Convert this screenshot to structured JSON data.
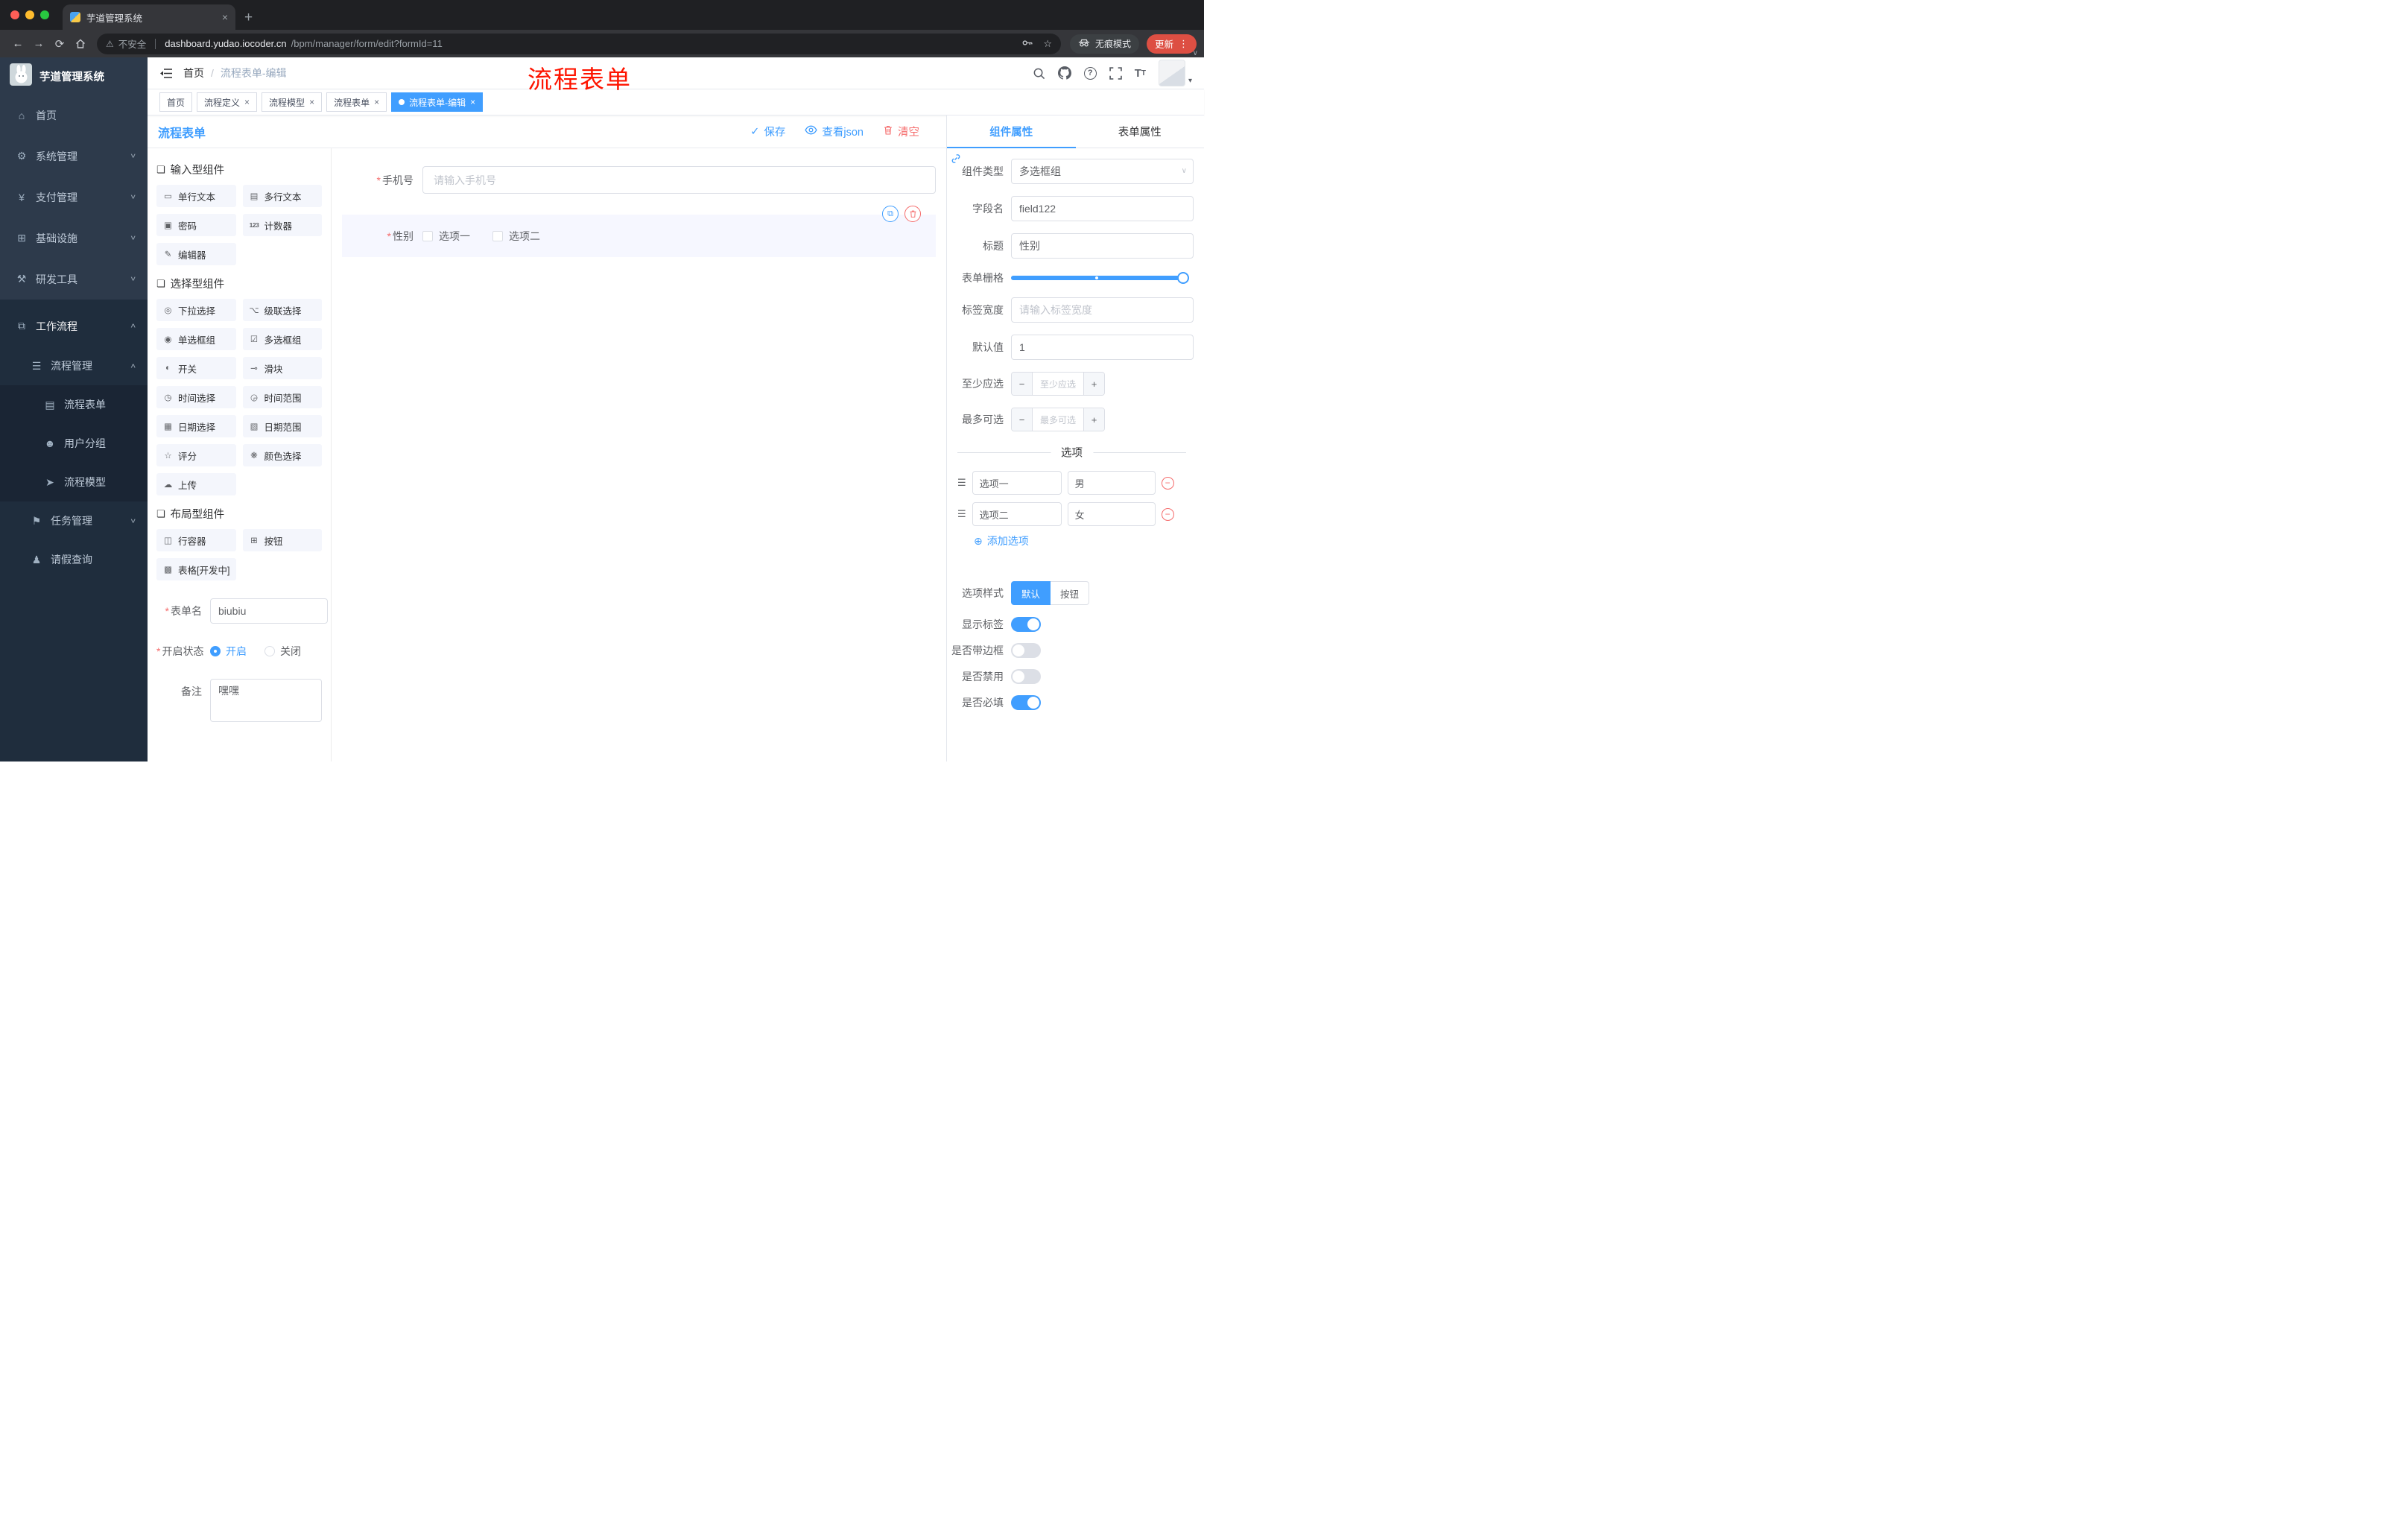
{
  "browser": {
    "tab_title": "芋道管理系统",
    "security_label": "不安全",
    "url_domain": "dashboard.yudao.iocoder.cn",
    "url_path": "/bpm/manager/form/edit?formId=11",
    "incognito_label": "无痕模式",
    "update_label": "更新"
  },
  "annotation": "流程表单",
  "sidebar": {
    "logo_title": "芋道管理系统",
    "items": [
      {
        "label": "首页",
        "icon": "⌂"
      },
      {
        "label": "系统管理",
        "icon": "⚙"
      },
      {
        "label": "支付管理",
        "icon": "¥"
      },
      {
        "label": "基础设施",
        "icon": "⊞"
      },
      {
        "label": "研发工具",
        "icon": "⚒"
      },
      {
        "label": "工作流程",
        "icon": "⧉"
      },
      {
        "label": "流程管理",
        "icon": "☰"
      },
      {
        "label": "流程表单",
        "icon": "▤"
      },
      {
        "label": "用户分组",
        "icon": "☻"
      },
      {
        "label": "流程模型",
        "icon": "➤"
      },
      {
        "label": "任务管理",
        "icon": "⚑"
      },
      {
        "label": "请假查询",
        "icon": "♟"
      }
    ]
  },
  "header": {
    "breadcrumb_home": "首页",
    "breadcrumb_sep": "/",
    "breadcrumb_current": "流程表单-编辑"
  },
  "tags": [
    {
      "label": "首页"
    },
    {
      "label": "流程定义"
    },
    {
      "label": "流程模型"
    },
    {
      "label": "流程表单"
    },
    {
      "label": "流程表单-编辑"
    }
  ],
  "designer": {
    "panel_title": "流程表单",
    "toolbar": {
      "save": "保存",
      "view_json": "查看json",
      "clear": "清空"
    },
    "palette": {
      "sections": [
        {
          "title": "输入型组件",
          "items": [
            {
              "label": "单行文本",
              "icon": "▭"
            },
            {
              "label": "多行文本",
              "icon": "▤"
            },
            {
              "label": "密码",
              "icon": "▣"
            },
            {
              "label": "计数器",
              "icon": "123"
            },
            {
              "label": "编辑器",
              "icon": "✎"
            }
          ]
        },
        {
          "title": "选择型组件",
          "items": [
            {
              "label": "下拉选择",
              "icon": "◎"
            },
            {
              "label": "级联选择",
              "icon": "⌥"
            },
            {
              "label": "单选框组",
              "icon": "◉"
            },
            {
              "label": "多选框组",
              "icon": "☑"
            },
            {
              "label": "开关",
              "icon": "◐"
            },
            {
              "label": "滑块",
              "icon": "⊸"
            },
            {
              "label": "时间选择",
              "icon": "◷"
            },
            {
              "label": "时间范围",
              "icon": "◶"
            },
            {
              "label": "日期选择",
              "icon": "▦"
            },
            {
              "label": "日期范围",
              "icon": "▧"
            },
            {
              "label": "评分",
              "icon": "☆"
            },
            {
              "label": "颜色选择",
              "icon": "❋"
            },
            {
              "label": "上传",
              "icon": "☁"
            }
          ]
        },
        {
          "title": "布局型组件",
          "items": [
            {
              "label": "行容器",
              "icon": "◫"
            },
            {
              "label": "按钮",
              "icon": "⊞"
            },
            {
              "label": "表格[开发中]",
              "icon": "▩"
            }
          ]
        }
      ]
    },
    "meta": {
      "name_label": "表单名",
      "name_value": "biubiu",
      "status_label": "开启状态",
      "status_on": "开启",
      "status_off": "关闭",
      "remark_label": "备注",
      "remark_value": "嘿嘿"
    },
    "canvas": {
      "phone_label": "手机号",
      "phone_placeholder": "请输入手机号",
      "gender_label": "性别",
      "gender_options": [
        {
          "label": "选项一"
        },
        {
          "label": "选项二"
        }
      ]
    }
  },
  "props": {
    "tab_component": "组件属性",
    "tab_form": "表单属性",
    "component_type_label": "组件类型",
    "component_type_value": "多选框组",
    "field_label": "字段名",
    "field_value": "field122",
    "title_label": "标题",
    "title_value": "性别",
    "grid_label": "表单栅格",
    "label_width_label": "标签宽度",
    "label_width_placeholder": "请输入标签宽度",
    "default_label": "默认值",
    "default_value": "1",
    "min_label": "至少应选",
    "min_placeholder": "至少应选",
    "max_label": "最多可选",
    "max_placeholder": "最多可选",
    "options_title": "选项",
    "options": [
      {
        "name": "选项一",
        "value": "男"
      },
      {
        "name": "选项二",
        "value": "女"
      }
    ],
    "add_option": "添加选项",
    "style_label": "选项样式",
    "style_default": "默认",
    "style_button": "按钮",
    "switch_rows": [
      {
        "label": "显示标签"
      },
      {
        "label": "是否带边框"
      },
      {
        "label": "是否禁用"
      },
      {
        "label": "是否必填"
      }
    ]
  },
  "icons": {
    "back": "←",
    "forward": "→",
    "reload": "⟳",
    "warning": "⚠",
    "star": "☆",
    "plus": "+",
    "close": "×",
    "more": "⋮",
    "caret_down": "▾",
    "chevron_down": "∨",
    "chevron_up": "∧",
    "check": "✓",
    "copy": "⧉",
    "question": "?",
    "cube": "❏",
    "drag": "☰",
    "minus": "−",
    "add_circle": "⊕",
    "asterisk": "*",
    "dots3": "⋮"
  }
}
